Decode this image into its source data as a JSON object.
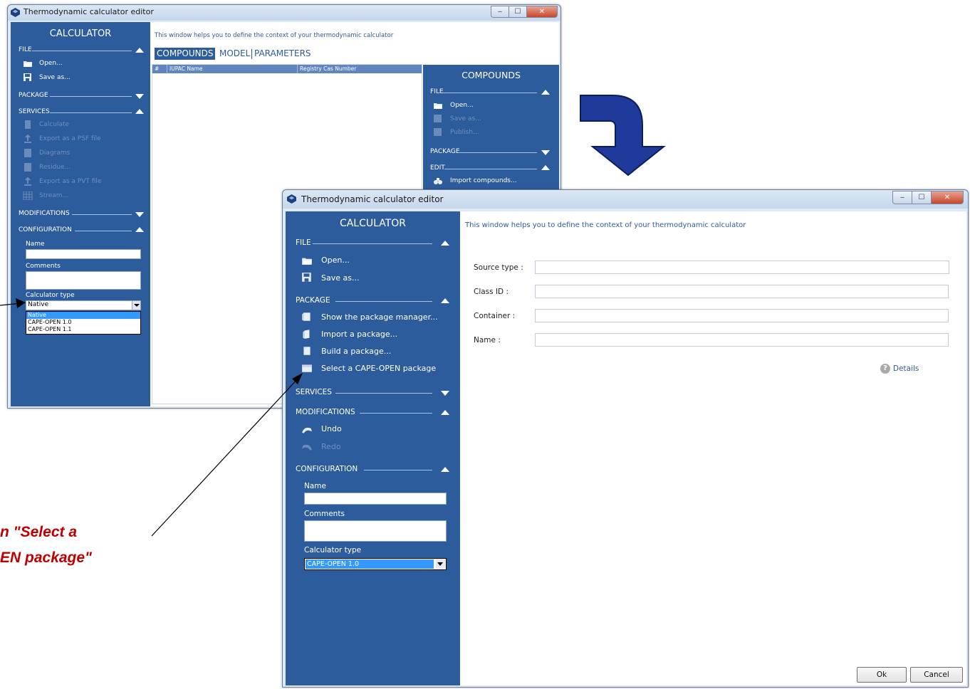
{
  "window_title": "Thermodynamic calculator editor",
  "back_window": {
    "sidebar_title": "CALCULATOR",
    "sections": {
      "file": "FILE",
      "package": "PACKAGE",
      "services": "SERVICES",
      "modifications": "MODIFICATIONS",
      "configuration": "CONFIGURATION"
    },
    "file_items": [
      "Open...",
      "Save as..."
    ],
    "service_items": [
      "Calculate",
      "Export as a PSF file",
      "Diagrams",
      "Residue...",
      "Export as a PVT file",
      "Stream..."
    ],
    "config": {
      "name_label": "Name",
      "comments_label": "Comments",
      "calc_type_label": "Calculator type",
      "calc_type_value": "Native",
      "dropdown_options": [
        "Native",
        "CAPE-OPEN 1.0",
        "CAPE-OPEN 1.1"
      ]
    },
    "info_text": "This window helps you to define the context of your thermodynamic calculator",
    "tabs": [
      "COMPOUNDS",
      "MODEL",
      "PARAMETERS"
    ],
    "table_headers": [
      "#",
      "IUPAC Name",
      "Registry Cas Number"
    ],
    "right_panel": {
      "title": "COMPOUNDS",
      "file_section": "FILE",
      "file_items": [
        "Open...",
        "Save as...",
        "Publish..."
      ],
      "package_section": "PACKAGE",
      "edit_section": "EDIT",
      "edit_items": [
        "Import compounds..."
      ]
    }
  },
  "front_window": {
    "sidebar_title": "CALCULATOR",
    "sections": {
      "file": "FILE",
      "package": "PACKAGE",
      "services": "SERVICES",
      "modifications": "MODIFICATIONS",
      "configuration": "CONFIGURATION"
    },
    "file_items": [
      "Open...",
      "Save as..."
    ],
    "package_items": [
      "Show the package manager...",
      "Import a package...",
      "Build a package...",
      "Select a CAPE-OPEN package"
    ],
    "modification_items": [
      "Undo",
      "Redo"
    ],
    "config": {
      "name_label": "Name",
      "comments_label": "Comments",
      "calc_type_label": "Calculator type",
      "calc_type_value": "CAPE-OPEN 1.0"
    },
    "info_text": "This window helps you to define the context of your thermodynamic calculator",
    "form": {
      "source_type": "Source type :",
      "class_id": "Class ID :",
      "container": "Container :",
      "name": "Name :"
    },
    "details_label": "Details",
    "ok_label": "Ok",
    "cancel_label": "Cancel"
  },
  "callout": {
    "line1": "n  \"Select a",
    "line2": "EN package\""
  },
  "colors": {
    "sidebar": "#2d5c9c",
    "callout": "#c00000",
    "arrow": "#1f3a9a",
    "selection": "#3399ff"
  }
}
